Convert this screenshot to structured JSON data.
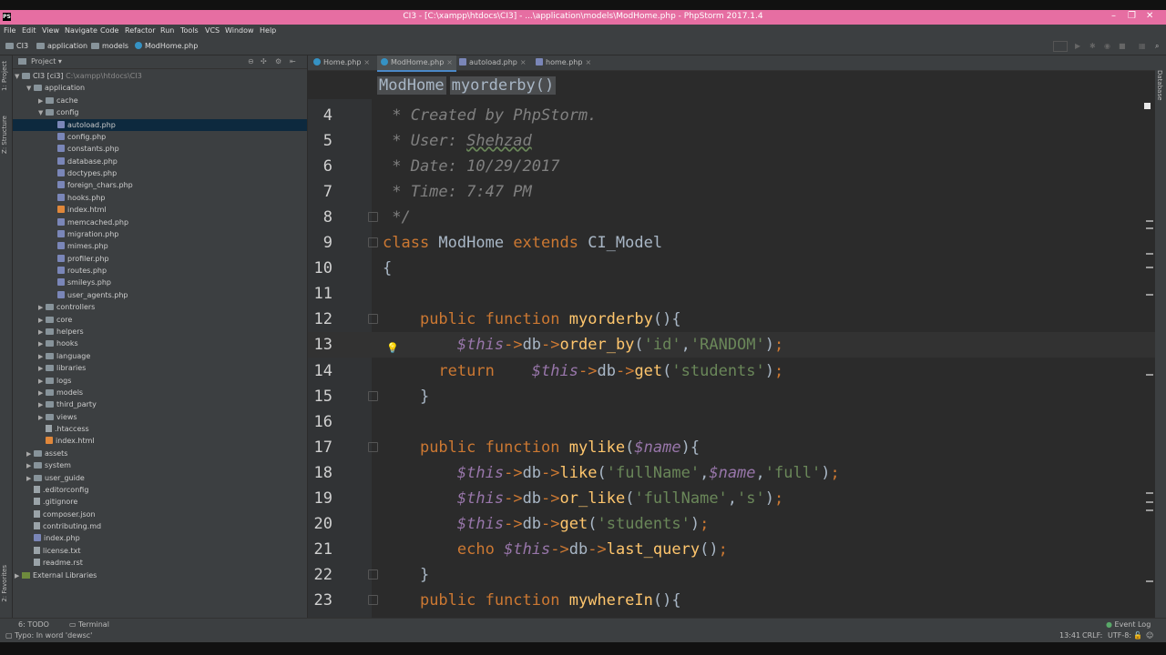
{
  "window": {
    "title": "CI3 - [C:\\xampp\\htdocs\\CI3] - ...\\application\\models\\ModHome.php - PhpStorm 2017.1.4",
    "app_icon": "PS"
  },
  "menu": [
    "File",
    "Edit",
    "View",
    "Navigate",
    "Code",
    "Refactor",
    "Run",
    "Tools",
    "VCS",
    "Window",
    "Help"
  ],
  "breadcrumb": [
    "CI3",
    "application",
    "models",
    "ModHome.php"
  ],
  "project_panel": {
    "title": "Project",
    "tree": [
      {
        "label": "CI3 [ci3]",
        "path": "C:\\xampp\\htdocs\\CI3",
        "depth": 0,
        "type": "folder",
        "open": true
      },
      {
        "label": "application",
        "depth": 1,
        "type": "folder",
        "open": true
      },
      {
        "label": "cache",
        "depth": 2,
        "type": "folder",
        "open": false
      },
      {
        "label": "config",
        "depth": 2,
        "type": "folder",
        "open": true
      },
      {
        "label": "autoload.php",
        "depth": 3,
        "type": "php",
        "selected": true
      },
      {
        "label": "config.php",
        "depth": 3,
        "type": "php"
      },
      {
        "label": "constants.php",
        "depth": 3,
        "type": "php"
      },
      {
        "label": "database.php",
        "depth": 3,
        "type": "php"
      },
      {
        "label": "doctypes.php",
        "depth": 3,
        "type": "php"
      },
      {
        "label": "foreign_chars.php",
        "depth": 3,
        "type": "php"
      },
      {
        "label": "hooks.php",
        "depth": 3,
        "type": "php"
      },
      {
        "label": "index.html",
        "depth": 3,
        "type": "html"
      },
      {
        "label": "memcached.php",
        "depth": 3,
        "type": "php"
      },
      {
        "label": "migration.php",
        "depth": 3,
        "type": "php"
      },
      {
        "label": "mimes.php",
        "depth": 3,
        "type": "php"
      },
      {
        "label": "profiler.php",
        "depth": 3,
        "type": "php"
      },
      {
        "label": "routes.php",
        "depth": 3,
        "type": "php"
      },
      {
        "label": "smileys.php",
        "depth": 3,
        "type": "php"
      },
      {
        "label": "user_agents.php",
        "depth": 3,
        "type": "php"
      },
      {
        "label": "controllers",
        "depth": 2,
        "type": "folder",
        "open": false
      },
      {
        "label": "core",
        "depth": 2,
        "type": "folder",
        "open": false
      },
      {
        "label": "helpers",
        "depth": 2,
        "type": "folder",
        "open": false
      },
      {
        "label": "hooks",
        "depth": 2,
        "type": "folder",
        "open": false
      },
      {
        "label": "language",
        "depth": 2,
        "type": "folder",
        "open": false
      },
      {
        "label": "libraries",
        "depth": 2,
        "type": "folder",
        "open": false
      },
      {
        "label": "logs",
        "depth": 2,
        "type": "folder",
        "open": false
      },
      {
        "label": "models",
        "depth": 2,
        "type": "folder",
        "open": false
      },
      {
        "label": "third_party",
        "depth": 2,
        "type": "folder",
        "open": false
      },
      {
        "label": "views",
        "depth": 2,
        "type": "folder",
        "open": false
      },
      {
        "label": ".htaccess",
        "depth": 2,
        "type": "file"
      },
      {
        "label": "index.html",
        "depth": 2,
        "type": "html"
      },
      {
        "label": "assets",
        "depth": 1,
        "type": "folder",
        "open": false
      },
      {
        "label": "system",
        "depth": 1,
        "type": "folder",
        "open": false
      },
      {
        "label": "user_guide",
        "depth": 1,
        "type": "folder",
        "open": false
      },
      {
        "label": ".editorconfig",
        "depth": 1,
        "type": "file"
      },
      {
        "label": ".gitignore",
        "depth": 1,
        "type": "file"
      },
      {
        "label": "composer.json",
        "depth": 1,
        "type": "file"
      },
      {
        "label": "contributing.md",
        "depth": 1,
        "type": "file"
      },
      {
        "label": "index.php",
        "depth": 1,
        "type": "php"
      },
      {
        "label": "license.txt",
        "depth": 1,
        "type": "file"
      },
      {
        "label": "readme.rst",
        "depth": 1,
        "type": "file"
      },
      {
        "label": "External Libraries",
        "depth": 0,
        "type": "lib",
        "open": false
      }
    ]
  },
  "editor_tabs": [
    {
      "label": "Home.php",
      "active": false
    },
    {
      "label": "ModHome.php",
      "active": true
    },
    {
      "label": "autoload.php",
      "active": false
    },
    {
      "label": "home.php",
      "active": false
    }
  ],
  "code_breadcrumb": [
    "ModHome",
    "myorderby()"
  ],
  "code_lines": [
    {
      "n": "4",
      "html": "<span class=\"cmt\"> * Created by PhpStorm.</span>"
    },
    {
      "n": "5",
      "html": "<span class=\"cmt\"> * User: <span class=\"ul\">Shehzad</span></span>"
    },
    {
      "n": "6",
      "html": "<span class=\"cmt\"> * Date: 10/29/2017</span>"
    },
    {
      "n": "7",
      "html": "<span class=\"cmt\"> * Time: 7:47 PM</span>"
    },
    {
      "n": "8",
      "html": "<span class=\"cmt\"> */</span>"
    },
    {
      "n": "9",
      "html": "<span class=\"kw\">class</span> ModHome <span class=\"kw\">extends</span> CI_Model"
    },
    {
      "n": "10",
      "html": "{"
    },
    {
      "n": "11",
      "html": ""
    },
    {
      "n": "12",
      "html": "    <span class=\"kw\">public function</span> <span class=\"fn\">myorderby</span>(){"
    },
    {
      "n": "13",
      "html": "        <span class=\"var\">$this</span><span class=\"kw\">-></span>db<span class=\"kw\">-></span><span class=\"fn\">order_by</span>(<span class=\"str\">'id'</span>,<span class=\"str\">'RANDOM'</span>)<span class=\"kw\">;</span>"
    },
    {
      "n": "14",
      "html": "      <span class=\"kw\">return</span>    <span class=\"var\">$this</span><span class=\"kw\">-></span>db<span class=\"kw\">-></span><span class=\"fn\">get</span>(<span class=\"str\">'students'</span>)<span class=\"kw\">;</span>"
    },
    {
      "n": "15",
      "html": "    }"
    },
    {
      "n": "16",
      "html": ""
    },
    {
      "n": "17",
      "html": "    <span class=\"kw\">public function</span> <span class=\"fn\">mylike</span>(<span class=\"var\">$name</span>){"
    },
    {
      "n": "18",
      "html": "        <span class=\"var\">$this</span><span class=\"kw\">-></span>db<span class=\"kw\">-></span><span class=\"fn\">like</span>(<span class=\"str\">'fullName'</span>,<span class=\"var\">$name</span>,<span class=\"str\">'full'</span>)<span class=\"kw\">;</span>"
    },
    {
      "n": "19",
      "html": "        <span class=\"var\">$this</span><span class=\"kw\">-></span>db<span class=\"kw\">-></span><span class=\"fn\">or_like</span>(<span class=\"str\">'fullName'</span>,<span class=\"str\">'s'</span>)<span class=\"kw\">;</span>"
    },
    {
      "n": "20",
      "html": "        <span class=\"var\">$this</span><span class=\"kw\">-></span>db<span class=\"kw\">-></span><span class=\"fn\">get</span>(<span class=\"str\">'students'</span>)<span class=\"kw\">;</span>"
    },
    {
      "n": "21",
      "html": "        <span class=\"kw\">echo</span> <span class=\"var\">$this</span><span class=\"kw\">-></span>db<span class=\"kw\">-></span><span class=\"fn\">last_query</span>()<span class=\"kw\">;</span>"
    },
    {
      "n": "22",
      "html": "    }"
    },
    {
      "n": "23",
      "html": "    <span class=\"kw\">public function</span> <span class=\"fn\">mywhereIn</span>(){"
    }
  ],
  "left_toolwindows": [
    "1: Project",
    "Z: Structure",
    "2: Favorites"
  ],
  "right_toolwindows": [
    "Database"
  ],
  "statusbar": {
    "todo": "6: TODO",
    "terminal": "Terminal",
    "event_log": "Event Log",
    "message": "Typo: In word 'dewsc'",
    "position": "13:41",
    "line_sep": "CRLF:",
    "encoding": "UTF-8:"
  }
}
